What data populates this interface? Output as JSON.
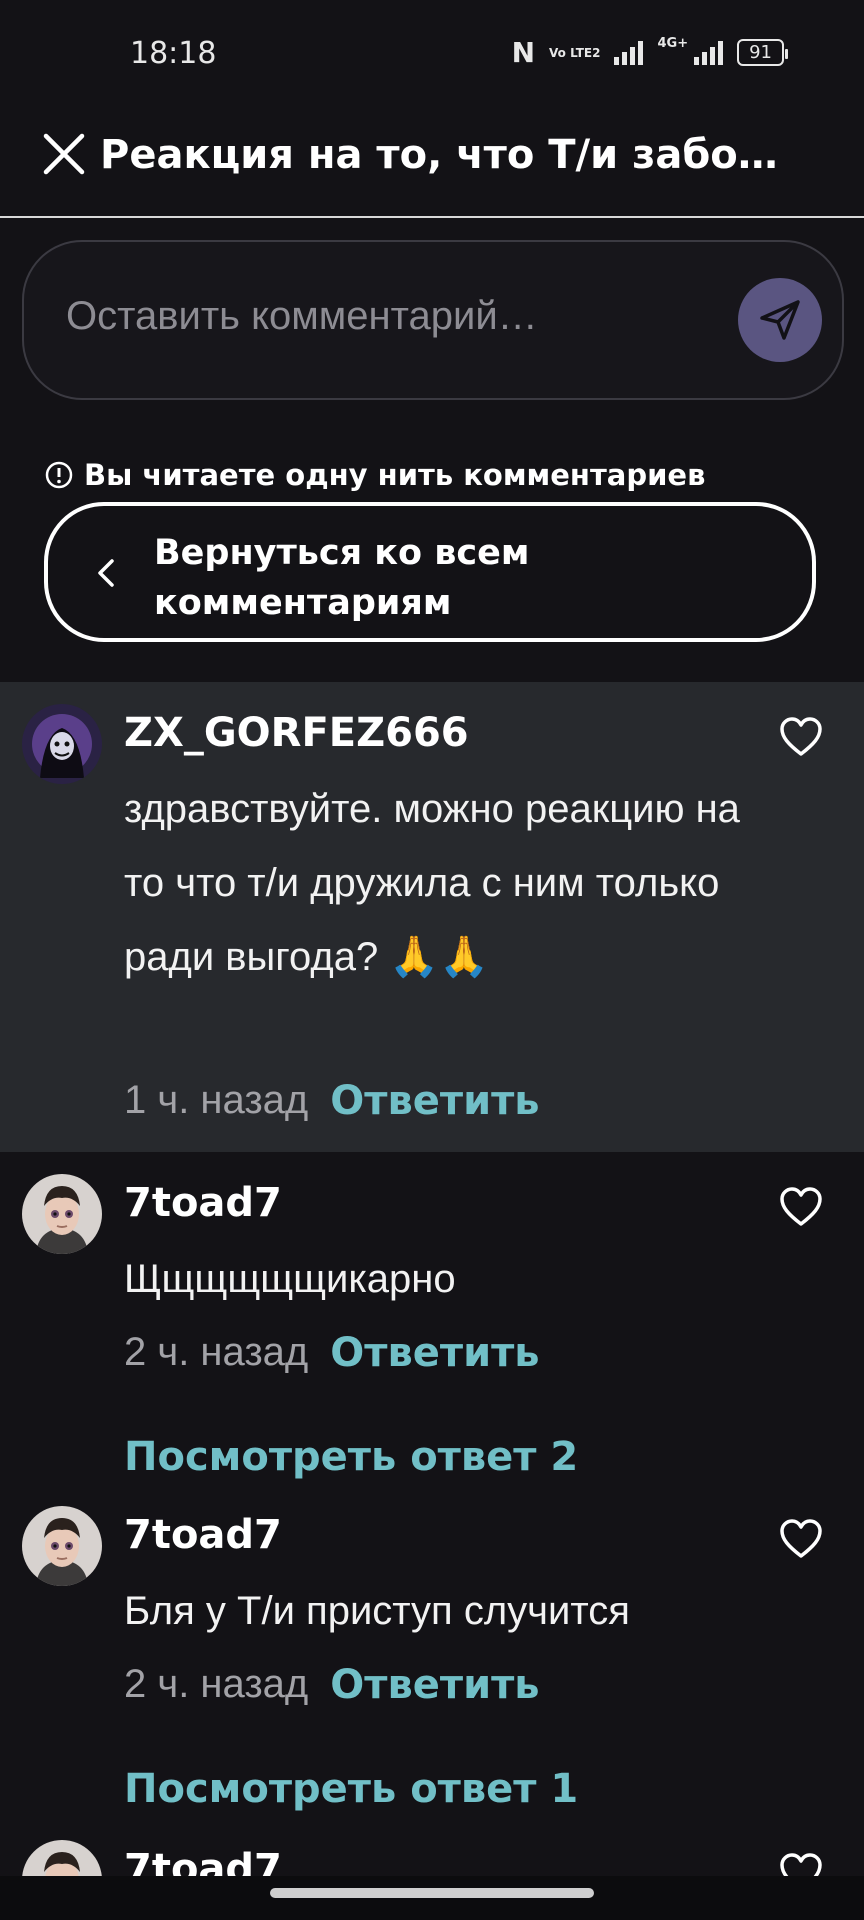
{
  "status_bar": {
    "time": "18:18",
    "volte": "Vo LTE2",
    "network": "4G+",
    "battery": "91"
  },
  "header": {
    "title": "Реакция на то, что Т/и забо…"
  },
  "composer": {
    "placeholder": "Оставить комментарий…"
  },
  "thread": {
    "notice": "Вы читаете одну нить комментариев",
    "back_label": "Вернуться ко всем комментариям"
  },
  "comments": [
    {
      "author": "ZX_GORFEZ666",
      "text": "здравствуйте. можно реакцию на то что т/и дружила с ним только ради выгода? 🙏🙏",
      "time": "1 ч. назад",
      "reply": "Ответить"
    },
    {
      "author": "7toad7",
      "text": "Щщщщщщикарно",
      "time": "2 ч. назад",
      "reply": "Ответить",
      "view_replies": "Посмотреть ответ 2"
    },
    {
      "author": "7toad7",
      "text": "Бля у Т/и приступ случится",
      "time": "2 ч. назад",
      "reply": "Ответить",
      "view_replies": "Посмотреть ответ 1"
    },
    {
      "author": "7toad7"
    }
  ],
  "colors": {
    "accent": "#71bfc7",
    "background": "#131216",
    "highlight": "#27292d",
    "send": "#5a5581"
  },
  "icons": [
    "close-icon",
    "send-icon",
    "info-icon",
    "chevron-left-icon",
    "heart-icon"
  ]
}
